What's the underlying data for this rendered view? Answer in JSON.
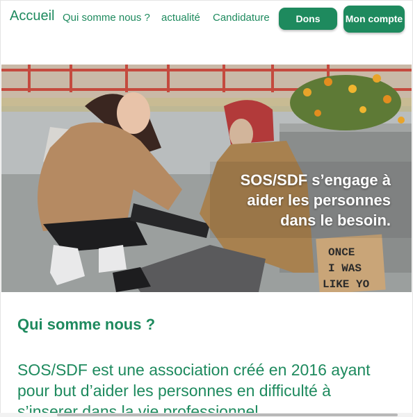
{
  "nav": {
    "brand": "Accueil",
    "links": [
      "Qui somme nous ?",
      "actualité",
      "Candidature"
    ],
    "donate_button": "Dons",
    "account_button": "Mon compte"
  },
  "hero": {
    "tagline": "SOS/SDF s’engage à aider les personnes dans le besoin.",
    "sign_text": "ONCE I WAS LIKE YOU"
  },
  "about": {
    "title": "Qui somme nous ?",
    "body": "SOS/SDF est une association créé en 2016 ayant pour but d’aider les personnes en difficulté à s’inserer dans la vie professionnel"
  },
  "colors": {
    "brand_green": "#1e8a5e",
    "background": "#ffffff"
  }
}
